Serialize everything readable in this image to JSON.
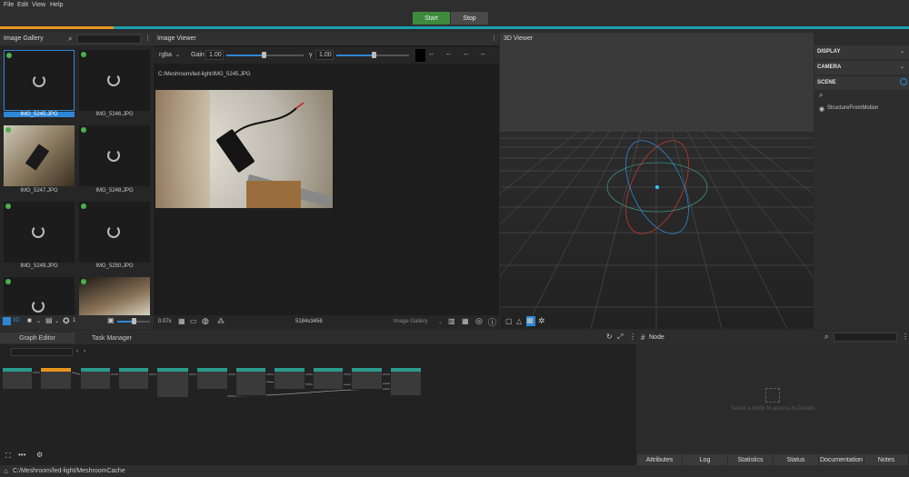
{
  "menu": [
    "File",
    "Edit",
    "View",
    "Help"
  ],
  "toolbar": {
    "start": "Start",
    "stop": "Stop"
  },
  "gallery": {
    "title": "Image Gallery",
    "items": [
      {
        "label": "IMG_5245.JPG"
      },
      {
        "label": "IMG_5246.JPG"
      },
      {
        "label": "IMG_5247.JPG"
      },
      {
        "label": "IMG_5248.JPG"
      },
      {
        "label": "IMG_5249.JPG"
      },
      {
        "label": "IMG_5250.JPG"
      }
    ],
    "footer": {
      "view3d": "3D",
      "count": "1"
    }
  },
  "viewer": {
    "title": "Image Viewer",
    "channel": "rgba",
    "gain_label": "Gain",
    "gain_value": "1.00",
    "gamma_label": "γ",
    "gamma_value": "1.00",
    "dashes": [
      "--",
      "--",
      "--",
      "--"
    ],
    "path": "C:/Meshroom/led-light/IMG_5245.JPG",
    "zoom": "0.07x",
    "resolution": "5184x3456",
    "source": "Image Gallery"
  },
  "viewer3d": {
    "title": "3D Viewer"
  },
  "scene_panel": {
    "display": "DISPLAY",
    "camera": "CAMERA",
    "scene": "SCENE",
    "entity": "StructureFromMotion"
  },
  "graph": {
    "tab_graph": "Graph Editor",
    "tab_tasks": "Task Manager"
  },
  "node_panel": {
    "title": "Node",
    "placeholder_text": "Select a Node to access its Details",
    "tabs": [
      "Attributes",
      "Log",
      "Statistics",
      "Status",
      "Documentation",
      "Notes"
    ]
  },
  "status_bar": {
    "path": "C:/Meshroom/led-light/MeshroomCache"
  },
  "colors": {
    "accent": "#2e86d6",
    "start": "#3d8a3d",
    "progress_teal": "#1aa0b0",
    "progress_orange": "#e6951e"
  }
}
